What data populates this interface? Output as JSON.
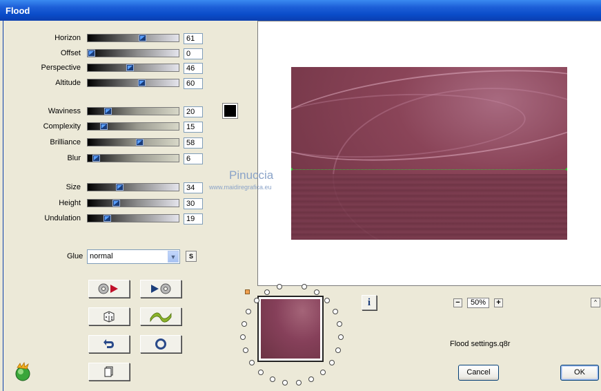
{
  "window": {
    "title": "Flood"
  },
  "sliders": [
    {
      "id": "horizon",
      "label": "Horizon",
      "value": "61",
      "fraction": 0.61,
      "style": "a"
    },
    {
      "id": "offset",
      "label": "Offset",
      "value": "0",
      "fraction": 0.0,
      "style": "a"
    },
    {
      "id": "perspective",
      "label": "Perspective",
      "value": "46",
      "fraction": 0.46,
      "style": "a"
    },
    {
      "id": "altitude",
      "label": "Altitude",
      "value": "60",
      "fraction": 0.6,
      "style": "a"
    },
    {
      "id": "waviness",
      "label": "Waviness",
      "value": "20",
      "fraction": 0.2,
      "style": "b"
    },
    {
      "id": "complexity",
      "label": "Complexity",
      "value": "15",
      "fraction": 0.15,
      "style": "b"
    },
    {
      "id": "brilliance",
      "label": "Brilliance",
      "value": "58",
      "fraction": 0.58,
      "style": "b"
    },
    {
      "id": "blur",
      "label": "Blur",
      "value": "6",
      "fraction": 0.06,
      "style": "b"
    },
    {
      "id": "size",
      "label": "Size",
      "value": "34",
      "fraction": 0.34,
      "style": "a"
    },
    {
      "id": "height",
      "label": "Height",
      "value": "30",
      "fraction": 0.3,
      "style": "a"
    },
    {
      "id": "undulation",
      "label": "Undulation",
      "value": "19",
      "fraction": 0.19,
      "style": "a"
    }
  ],
  "glue": {
    "label": "Glue",
    "value": "normal",
    "s_label": "S"
  },
  "watermark": {
    "name": "Pinuccia",
    "site": "www.maidiregrafica.eu"
  },
  "zoom": {
    "minus": "−",
    "value": "50%",
    "plus": "+"
  },
  "info_label": "i",
  "up_label": "^",
  "settings_file": "Flood settings.q8r",
  "buttons": {
    "cancel": "Cancel",
    "ok": "OK"
  },
  "colors": {
    "title_bar": "#0a4cc9",
    "dialog_bg": "#ece9d8",
    "color_well": "#000000",
    "preview_tint": "#7a3a4c"
  }
}
